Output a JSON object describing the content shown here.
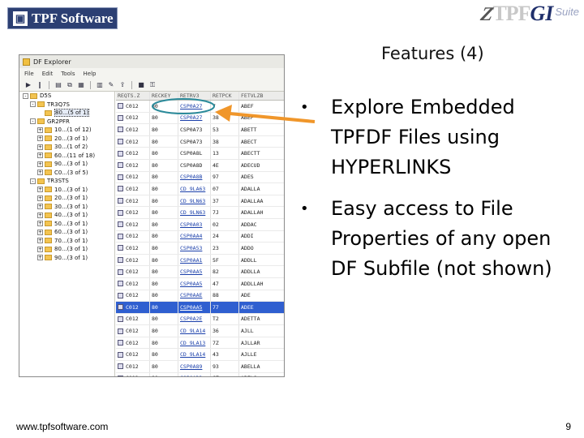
{
  "header": {
    "logo_left_text": "TPF Software",
    "logo_right": {
      "z": "Z",
      "tpf": "TPF",
      "gi": "GI",
      "suite": "Suite"
    }
  },
  "slide": {
    "title": "Features (4)",
    "bullets": [
      "Explore Embedded TPFDF Files using HYPERLINKS",
      "Easy access to File Properties of any open DF Subfile (not shown)"
    ],
    "bullet_glyph": "•"
  },
  "footer": {
    "url": "www.tpfsoftware.com",
    "page": "9"
  },
  "explorer": {
    "window_title": "DF Explorer",
    "menu": [
      "File",
      "Edit",
      "Tools",
      "Help"
    ],
    "toolbar_icons": [
      "run-icon",
      "pause-icon",
      "open-icon",
      "copy-icon",
      "paste-icon",
      "grid-icon",
      "tools-icon",
      "export-icon",
      "lock-icon",
      "key-icon"
    ],
    "tree": [
      {
        "label": "D5S",
        "depth": 0,
        "exp": "-"
      },
      {
        "label": "TR3Q7S",
        "depth": 1,
        "exp": "-"
      },
      {
        "label": "80...(5 of 1)",
        "depth": 2,
        "exp": "",
        "selected": true
      },
      {
        "label": "GR2PFR",
        "depth": 1,
        "exp": "-"
      },
      {
        "label": "10...(1 of 12)",
        "depth": 2,
        "exp": "+"
      },
      {
        "label": "20...(3 of 1)",
        "depth": 2,
        "exp": "+"
      },
      {
        "label": "30...(1 of 2)",
        "depth": 2,
        "exp": "+"
      },
      {
        "label": "60...(11 of 18)",
        "depth": 2,
        "exp": "+"
      },
      {
        "label": "90...(3 of 1)",
        "depth": 2,
        "exp": "+"
      },
      {
        "label": "C0...(3 of 5)",
        "depth": 2,
        "exp": "+"
      },
      {
        "label": "TR3STS",
        "depth": 1,
        "exp": "-"
      },
      {
        "label": "10...(3 of 1)",
        "depth": 2,
        "exp": "+"
      },
      {
        "label": "20...(3 of 1)",
        "depth": 2,
        "exp": "+"
      },
      {
        "label": "30...(3 of 1)",
        "depth": 2,
        "exp": "+"
      },
      {
        "label": "40...(3 of 1)",
        "depth": 2,
        "exp": "+"
      },
      {
        "label": "50...(3 of 1)",
        "depth": 2,
        "exp": "+"
      },
      {
        "label": "60...(3 of 1)",
        "depth": 2,
        "exp": "+"
      },
      {
        "label": "70...(3 of 1)",
        "depth": 2,
        "exp": "+"
      },
      {
        "label": "80...(3 of 1)",
        "depth": 2,
        "exp": "+"
      },
      {
        "label": "90...(3 of 1)",
        "depth": 2,
        "exp": "+"
      }
    ],
    "columns": [
      "REQTS.Z",
      "RECKEY",
      "RETRV3",
      "RETPCK",
      "FETVLZB"
    ],
    "rows": [
      [
        "C012",
        "80",
        "CSP0A27",
        "7",
        "ABEF",
        "link"
      ],
      [
        "C012",
        "80",
        "CSP0A27",
        "38",
        "ABEF",
        "link"
      ],
      [
        "C012",
        "80",
        "CSP0A73",
        "53",
        "ABETT",
        ""
      ],
      [
        "C012",
        "80",
        "CSP0A73",
        "38",
        "ABECT",
        ""
      ],
      [
        "C012",
        "80",
        "CSP0A8L",
        "13",
        "ABECTT",
        ""
      ],
      [
        "C012",
        "80",
        "CSP0A8D",
        "4E",
        "ADECUD",
        ""
      ],
      [
        "C012",
        "80",
        "CSP0A8B",
        "97",
        "ADES",
        "link"
      ],
      [
        "C012",
        "80",
        "CD 9LA63",
        "07",
        "ADALLA",
        "link"
      ],
      [
        "C012",
        "80",
        "CD 9LN63",
        "37",
        "ADALLAA",
        "link"
      ],
      [
        "C012",
        "80",
        "CD 9LN63",
        "7J",
        "ADALLAH",
        "link"
      ],
      [
        "C012",
        "80",
        "CSP0A03",
        "02",
        "ADDAC",
        "link"
      ],
      [
        "C012",
        "80",
        "CSP0AA4",
        "24",
        "ADDI",
        "link"
      ],
      [
        "C012",
        "80",
        "CSP0A53",
        "23",
        "ADDO",
        "link"
      ],
      [
        "C012",
        "80",
        "CSP0AA1",
        "5F",
        "ADDLL",
        "link"
      ],
      [
        "C012",
        "80",
        "CSP0AA5",
        "82",
        "ADDLLA",
        "link"
      ],
      [
        "C012",
        "80",
        "CSP0AA5",
        "47",
        "ADDLLAH",
        "link"
      ],
      [
        "C012",
        "80",
        "CSP0AAE",
        "88",
        "ADE",
        "link"
      ],
      [
        "C012",
        "80",
        "CSP0AA5",
        "77",
        "ADEE",
        "link",
        "selected"
      ],
      [
        "C012",
        "80",
        "CSP0A2E",
        "T2",
        "ADETTA",
        "link"
      ],
      [
        "C012",
        "80",
        "CD 9LA14",
        "36",
        "AJLL",
        "link"
      ],
      [
        "C012",
        "80",
        "CD 9LA13",
        "7Z",
        "AJLLAR",
        "link"
      ],
      [
        "C012",
        "80",
        "CD 9LA14",
        "43",
        "AJLLE",
        "link"
      ],
      [
        "C012",
        "80",
        "CSP0A89",
        "93",
        "ABELLA",
        "link"
      ],
      [
        "C012",
        "80",
        "CSP0AD3",
        "CZ",
        "ABELS",
        "link"
      ],
      [
        "C012",
        "80",
        "CSP0AD1",
        "33",
        "ABELSON",
        "link"
      ]
    ]
  },
  "colors": {
    "logo_bg": "#2c3f73",
    "arrow": "#f0962a",
    "ellipse": "#2a8a9a",
    "row_selected": "#2f5fd0"
  }
}
